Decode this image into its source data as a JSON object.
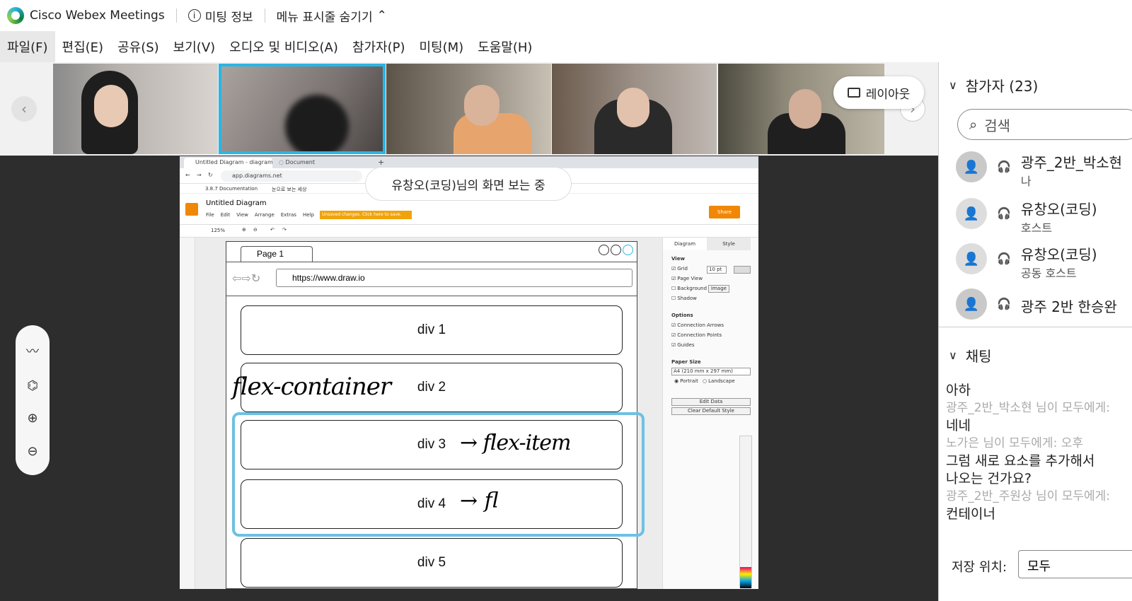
{
  "titlebar": {
    "app_name": "Cisco Webex Meetings",
    "meeting_info": "미팅 정보",
    "hide_menu": "메뉴 표시줄 숨기기"
  },
  "menu": [
    {
      "label": "파일(F)"
    },
    {
      "label": "편집(E)"
    },
    {
      "label": "공유(S)"
    },
    {
      "label": "보기(V)"
    },
    {
      "label": "오디오 및 비디오(A)"
    },
    {
      "label": "참가자(P)"
    },
    {
      "label": "미팅(M)"
    },
    {
      "label": "도움말(H)"
    }
  ],
  "layout_button": "레이아웃",
  "viewing_banner": "유창오(코딩)님의 화면 보는 중",
  "browser": {
    "tab1": "Untitled Diagram - diagrams.net",
    "tab2": "Document",
    "url": "app.diagrams.net",
    "bookmark1": "3.8.7 Documentation",
    "bookmark2": "눈으로 보는 세상"
  },
  "drawio": {
    "doc_title": "Untitled Diagram",
    "menus": [
      "File",
      "Edit",
      "View",
      "Arrange",
      "Extras",
      "Help"
    ],
    "unsaved": "Unsaved changes. Click here to save.",
    "share": "Share",
    "zoom": "125%",
    "panel_tab_diagram": "Diagram",
    "panel_tab_style": "Style",
    "view_label": "View",
    "grid_label": "Grid",
    "grid_value": "10 pt",
    "page_view": "Page View",
    "background": "Background",
    "image_btn": "Image",
    "shadow": "Shadow",
    "options_label": "Options",
    "opt1": "Connection Arrows",
    "opt2": "Connection Points",
    "opt3": "Guides",
    "paper_size": "Paper Size",
    "paper_value": "A4 (210 mm x 297 mm)",
    "portrait": "Portrait",
    "landscape": "Landscape",
    "edit_data": "Edit Data",
    "clear_style": "Clear Default Style"
  },
  "canvas": {
    "page_tab": "Page 1",
    "mock_url": "https://www.draw.io",
    "divs": [
      "div 1",
      "div 2",
      "div 3",
      "div 4",
      "div 5"
    ],
    "handwriting": {
      "container": "flex-container",
      "item": "→ flex-item",
      "partial": "→ fl"
    }
  },
  "participants": {
    "header": "참가자 (23)",
    "search_placeholder": "검색",
    "list": [
      {
        "name": "광주_2반_박소현",
        "role": "나"
      },
      {
        "name": "유창오(코딩)",
        "role": "호스트"
      },
      {
        "name": "유창오(코딩)",
        "role": "공동 호스트"
      },
      {
        "name": "광주 2반 한승완",
        "role": ""
      }
    ]
  },
  "chat": {
    "header": "채팅",
    "messages": [
      {
        "type": "text",
        "text": "아하"
      },
      {
        "type": "meta",
        "text": "광주_2반_박소현 님이 모두에게:"
      },
      {
        "type": "text",
        "text": "네네"
      },
      {
        "type": "meta",
        "text": "노가은 님이 모두에게:      오후"
      },
      {
        "type": "text",
        "text": "그럼 새로 요소를 추가해서"
      },
      {
        "type": "text",
        "text": "나오는 건가요?"
      },
      {
        "type": "meta",
        "text": "광주_2반_주원상 님이 모두에게:"
      },
      {
        "type": "text",
        "text": "컨테이너"
      }
    ],
    "save_label": "저장 위치:",
    "save_value": "모두"
  },
  "colors": {
    "accent": "#29b6e6",
    "highlight": "#6ec0e4",
    "warn": "#f0a30a"
  }
}
